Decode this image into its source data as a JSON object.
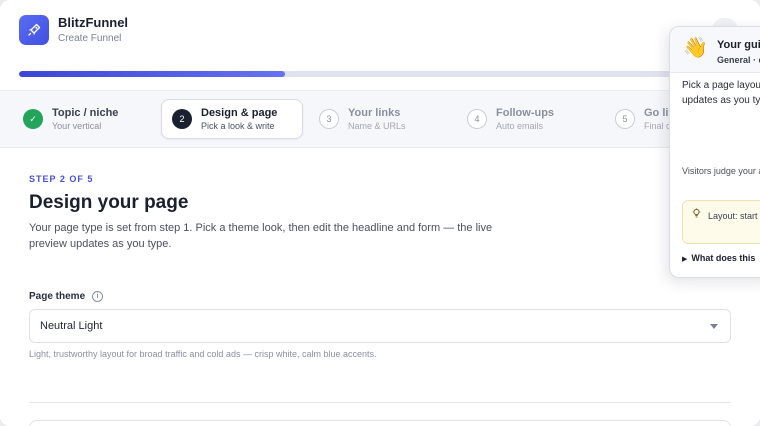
{
  "header": {
    "brand": "BlitzFunnel",
    "subtitle": "Create Funnel",
    "logo_icon": "rocket-icon",
    "progress_fraction": 0.38
  },
  "steps": [
    {
      "number": "✓",
      "title": "Topic / niche",
      "subtitle": "Your vertical",
      "state": "done"
    },
    {
      "number": "2",
      "title": "Design & page",
      "subtitle": "Pick a look & write",
      "state": "active"
    },
    {
      "number": "3",
      "title": "Your links",
      "subtitle": "Name & URLs",
      "state": "todo"
    },
    {
      "number": "4",
      "title": "Follow-ups",
      "subtitle": "Auto emails",
      "state": "todo"
    },
    {
      "number": "5",
      "title": "Go liv",
      "subtitle": "Final c",
      "state": "todo"
    }
  ],
  "main": {
    "eyebrow": "STEP 2 OF 5",
    "title": "Design your page",
    "description": "Your page type is set from step 1. Pick a theme look, then edit the headline and form — the live preview updates as you type.",
    "theme_label": "Page theme",
    "theme_value": "Neutral Light",
    "theme_hint": "Light, trustworthy layout for broad traffic and cold ads — crisp white, calm blue accents."
  },
  "guide": {
    "emoji": "👋",
    "title": "Your gui",
    "meta": "General · c",
    "p1": "Pick a page layou headline and form updates as you ty thumbnails. Niche starter.",
    "p2": "Visitors judge your and writing on one",
    "tip_icon": "lightbulb-icon",
    "tip_text": "Layout: start updates as yo",
    "details_label": "What does this"
  }
}
